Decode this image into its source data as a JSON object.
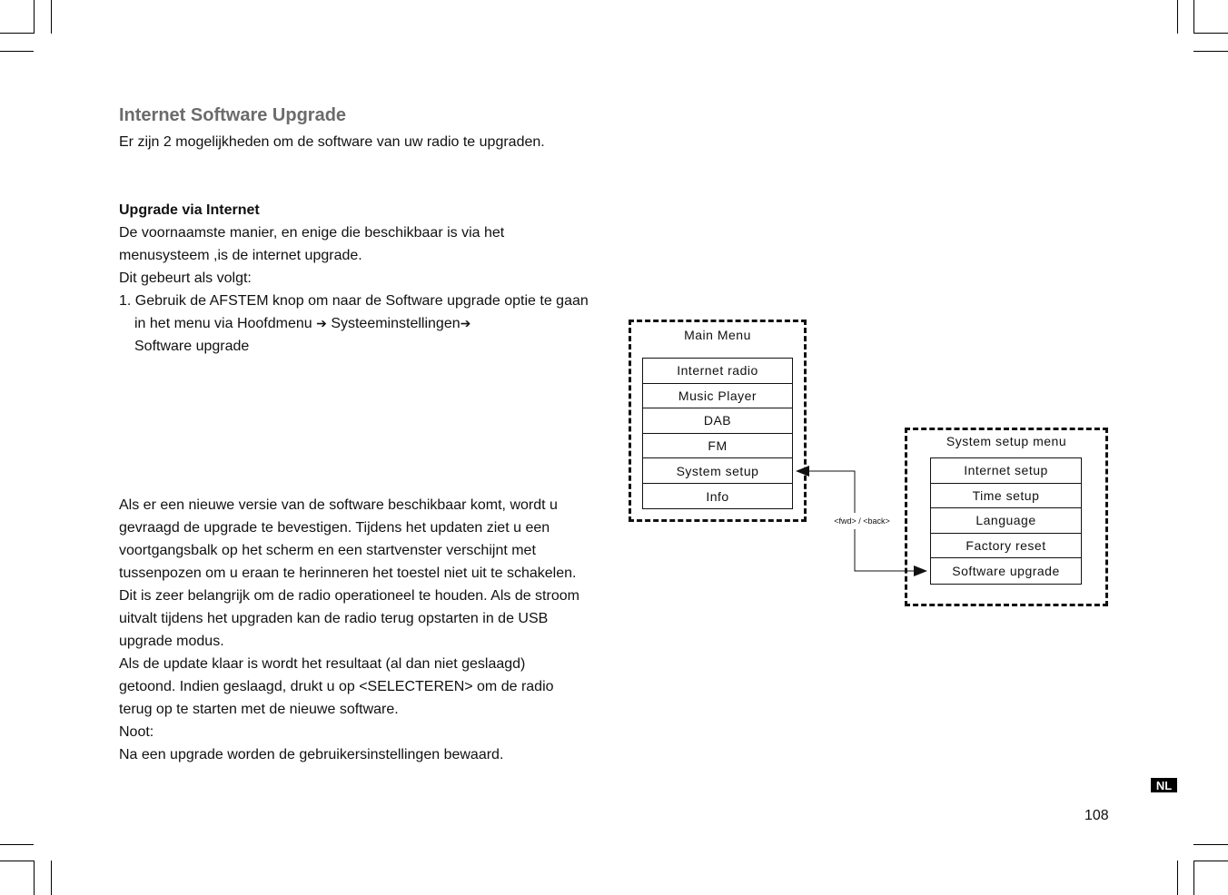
{
  "heading": "Internet Software Upgrade",
  "intro": "Er zijn 2 mogelijkheden om de software van uw radio te upgraden.",
  "section": {
    "title": "Upgrade via Internet",
    "lines": [
      "De voornaamste manier, en enige die beschikbaar is via het",
      "menusysteem ,is de internet upgrade.",
      "Dit gebeurt als volgt:"
    ],
    "step": {
      "number": "1.",
      "line1": "Gebruik de AFSTEM knop om naar de Software upgrade optie te gaan",
      "line2_prefix": "in het menu via Hoofdmenu",
      "arrow": "➔",
      "line2_mid": "Systeeminstellingen",
      "line3": "Software upgrade"
    }
  },
  "body_lines": [
    "Als er een nieuwe versie van de software beschikbaar komt, wordt u",
    "gevraagd de upgrade te bevestigen. Tijdens het updaten ziet u een",
    "voortgangsbalk op het scherm en een startvenster verschijnt met",
    "tussenpozen om u eraan te herinneren het toestel niet uit te schakelen.",
    "Dit is zeer belangrijk om de radio operationeel te houden. Als de stroom",
    "uitvalt tijdens het upgraden kan de radio terug opstarten in de USB",
    "upgrade modus.",
    "Als de update klaar is wordt het resultaat (al dan niet geslaagd)",
    "getoond. Indien geslaagd, drukt u op <SELECTEREN> om de radio",
    "terug op te starten met de nieuwe software.",
    "Noot:",
    "Na een upgrade worden de gebruikersinstellingen bewaard."
  ],
  "diagram": {
    "main_menu": {
      "title": "Main Menu",
      "items": [
        "Internet radio",
        "Music Player",
        "DAB",
        "FM",
        "System setup",
        "Info"
      ]
    },
    "system_menu": {
      "title": "System setup menu",
      "items": [
        "Internet setup",
        "Time setup",
        "Language",
        "Factory reset",
        "Software upgrade"
      ]
    },
    "connector_label": "<fwd> / <back>"
  },
  "footer": {
    "language_badge": "NL",
    "page_number": "108"
  }
}
